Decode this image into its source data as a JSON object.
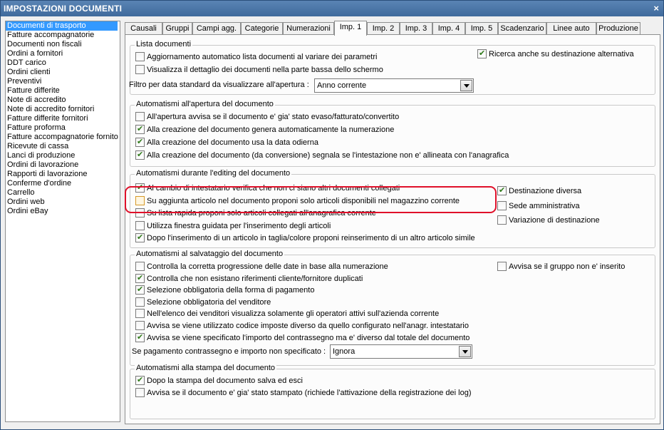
{
  "window": {
    "title": "IMPOSTAZIONI DOCUMENTI",
    "close_symbol": "×"
  },
  "doc_types": [
    "Documenti di trasporto",
    "Fatture accompagnatorie",
    "Documenti non fiscali",
    "Ordini a fornitori",
    "DDT carico",
    "Ordini clienti",
    "Preventivi",
    "Fatture differite",
    "Note di accredito",
    "Note di accredito fornitori",
    "Fatture differite fornitori",
    "Fatture proforma",
    "Fatture accompagnatorie fornito",
    "Ricevute di cassa",
    "Lanci di produzione",
    "Ordini di lavorazione",
    "Rapporti di lavorazione",
    "Conferme d'ordine",
    "Carrello",
    "Ordini web",
    "Ordini eBay"
  ],
  "selected_doc_type": "Documenti di trasporto",
  "tabs": [
    "Causali",
    "Gruppi",
    "Campi agg.",
    "Categorie",
    "Numerazioni",
    "Imp. 1",
    "Imp. 2",
    "Imp. 3",
    "Imp. 4",
    "Imp. 5",
    "Scadenzario",
    "Linee auto",
    "Produzione"
  ],
  "active_tab": "Imp. 1",
  "lista": {
    "title": "Lista documenti",
    "auto_update": {
      "label": "Aggiornamento automatico lista documenti al variare dei parametri",
      "checked": false
    },
    "show_detail": {
      "label": "Visualizza il dettaglio dei documenti nella parte bassa dello schermo",
      "checked": false
    },
    "search_alt_dest": {
      "label": "Ricerca anche su destinazione alternativa",
      "checked": true
    },
    "date_filter_label": "Filtro per data standard da visualizzare all'apertura :",
    "date_filter_value": "Anno corrente"
  },
  "apertura": {
    "title": "Automatismi all'apertura del documento",
    "items": [
      {
        "label": "All'apertura avvisa se il documento e' gia' stato evaso/fatturato/convertito",
        "checked": false
      },
      {
        "label": "Alla creazione del documento genera automaticamente la numerazione",
        "checked": true
      },
      {
        "label": "Alla creazione del documento usa la data odierna",
        "checked": true
      },
      {
        "label": "Alla creazione del documento (da conversione) segnala se l'intestazione non e' allineata con l'anagrafica",
        "checked": true
      }
    ]
  },
  "editing": {
    "title": "Automatismi durante l'editing del documento",
    "items": [
      {
        "label": "Al cambio di intestatario verifica che non ci siano altri documenti collegati",
        "checked": true
      },
      {
        "label": "Su aggiunta articolo nel documento proponi solo articoli disponibili nel magazzino corrente",
        "checked": false
      },
      {
        "label": "Su lista rapida proponi solo articoli collegati all'anagrafica corrente",
        "checked": false
      },
      {
        "label": "Utilizza finestra guidata per l'inserimento degli articoli",
        "checked": false
      },
      {
        "label": "Dopo l'inserimento di un articolo in taglia/colore proponi reinserimento di un altro articolo simile",
        "checked": true
      }
    ],
    "right": [
      {
        "label": "Destinazione diversa",
        "checked": true
      },
      {
        "label": "Sede amministrativa",
        "checked": false
      },
      {
        "label": "Variazione di destinazione",
        "checked": false
      }
    ]
  },
  "salvataggio": {
    "title": "Automatismi al salvataggio del documento",
    "items": [
      {
        "label": "Controlla la corretta progressione delle date in base alla numerazione",
        "checked": false
      },
      {
        "label": "Controlla che non esistano riferimenti cliente/fornitore duplicati",
        "checked": true
      },
      {
        "label": "Selezione obbligatoria della forma di pagamento",
        "checked": true
      },
      {
        "label": "Selezione obbligatoria del venditore",
        "checked": false
      },
      {
        "label": "Nell'elenco dei venditori visualizza solamente gli operatori attivi sull'azienda corrente",
        "checked": false
      },
      {
        "label": "Avvisa se viene utilizzato codice imposte diverso da quello configurato nell'anagr. intestatario",
        "checked": false
      },
      {
        "label": "Avvisa se viene specificato l'importo del contrassegno ma e' diverso dal totale del documento",
        "checked": true
      }
    ],
    "group_warn": {
      "label": "Avvisa se il gruppo non e' inserito",
      "checked": false
    },
    "contrassegno_label": "Se pagamento contrassegno e importo non specificato :",
    "contrassegno_value": "Ignora"
  },
  "stampa": {
    "title": "Automatismi alla stampa del documento",
    "items": [
      {
        "label": "Dopo la stampa del documento salva ed esci",
        "checked": true
      },
      {
        "label": "Avvisa se il documento e' gia' stato stampato (richiede l'attivazione della registrazione dei log)",
        "checked": false
      }
    ]
  },
  "colors": {
    "title_bar": "#3f6a9c",
    "selection": "#3399ff",
    "highlight_box": "#e0102a"
  }
}
